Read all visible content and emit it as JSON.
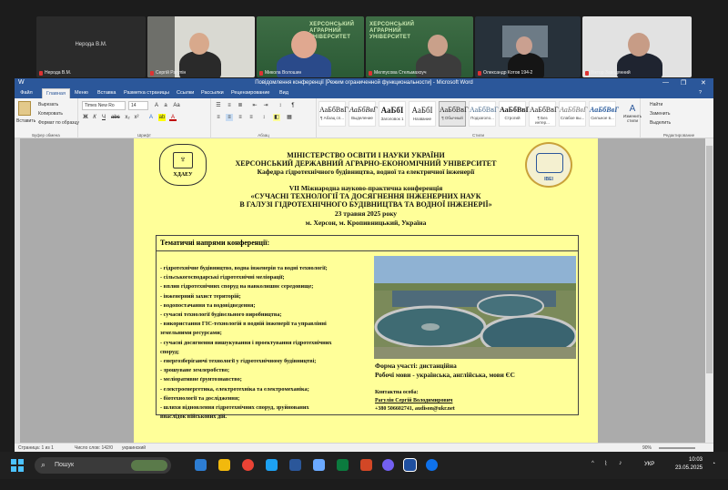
{
  "participants": [
    {
      "name": "Нерода В.М.",
      "caption": "Нерода В.М."
    },
    {
      "name": "Сергій Рагулін"
    },
    {
      "name": "Микола Волошин"
    },
    {
      "name": "Мелпусова Стельмахоуч"
    },
    {
      "name": "Олександр Котов 194-2"
    },
    {
      "name": "Віктор Заводянний"
    }
  ],
  "background_sign": "ХЕРСОНСЬКИЙ АГРАРНИЙ УНІВЕРСИТЕТ",
  "word": {
    "title": "Повідомлення конференції [Режим ограниченной функциональности] - Microsoft Word",
    "tabs": [
      "Файл",
      "Главная",
      "Меню",
      "Вставка",
      "Разметка страницы",
      "Ссылки",
      "Рассылки",
      "Рецензирование",
      "Вид"
    ],
    "ribbon": {
      "paste_label": "Вставить",
      "cut": "Вырезать",
      "copy": "Копировать",
      "format_painter": "Формат по образцу",
      "clipboard_group": "Буфер обмена",
      "font_name": "Times New Ro",
      "font_size": "14",
      "font_group": "Шрифт",
      "paragraph_group": "Абзац",
      "styles_group": "Стили",
      "styles": [
        {
          "sample": "АаБбВвГг,",
          "label": "¶ Абзац сп..."
        },
        {
          "sample": "АаБбВвГ",
          "label": "Выделение"
        },
        {
          "sample": "АаБбI",
          "label": "Заголовок 1"
        },
        {
          "sample": "АаБбI",
          "label": "Название"
        },
        {
          "sample": "АаБбВвГг",
          "label": "¶ Обычный"
        },
        {
          "sample": "АаБбВвГ",
          "label": "Подзаголо..."
        },
        {
          "sample": "АаБбВвГ",
          "label": "Строгий"
        },
        {
          "sample": "АаБбВвГ",
          "label": "¶ Без интер..."
        },
        {
          "sample": "АаБбВвГ",
          "label": "Слабое вы..."
        },
        {
          "sample": "АаБбВвГ",
          "label": "Сильное в..."
        }
      ],
      "change_styles": "Изменить стили",
      "find": "Найти",
      "replace": "Заменить",
      "select": "Выделить",
      "editing_group": "Редактирование"
    },
    "status": {
      "page": "Страница: 1 из 1",
      "words": "Число слов: 142/0",
      "language": "украинский",
      "zoom": "90%"
    }
  },
  "document": {
    "ministry": "МІНІСТЕРСТВО  ОСВІТИ  І НАУКИ УКРАЇНИ",
    "university": "ХЕРСОНСЬКИЙ ДЕРЖАВНИЙ АГРАРНО-ЕКОНОМІЧНИЙ  УНІВЕРСИТЕТ",
    "department": "Кафедра гідротехнічного будівництва, водної та електричної інженерії",
    "left_logo_text": "ХДАЕУ",
    "right_logo_text": "ІВЕІ",
    "conference_line": "VII Міжнародна науково-практична конференція",
    "conference_title_1": "«СУЧАСНІ  ТЕХНОЛОГІЇ  ТА ДОСЯГНЕННЯ  ІНЖЕНЕРНИХ  НАУК",
    "conference_title_2": "В ГАЛУЗІ ГІДРОТЕХНІЧНОГО  БУДІВНИЦТВА  ТА ВОДНОЇ ІНЖЕНЕРІЇ»",
    "date": "23 травня 2025 року",
    "place": "м. Херсон, м. Кропивницький, Україна",
    "topics_header": "Тематичні  напрями конференції:",
    "topics": [
      "- гідротехнічне будівництво, водна інженерія та водні технології;",
      "- сільськогосподарські гідротехнічні меліорації;",
      "- вплив гідротехнічних споруд на навколишнє середовище;",
      "- інженерний захист територій;",
      "- водопостачання та водовідведення;",
      "- сучасні технології будівельного виробництва;",
      "- використання ГІС-технологій в водній інженерії та управлінні",
      "   земельними ресурсами;",
      "- сучасні досягнення вишукування і проектування гідротехнічних",
      "   споруд;",
      "- енергозберігаючі технології у гідротехнічному будівництві;",
      "- зрошуване землеробство;",
      "- меліоративне ґрунтознавство;",
      "- електроенергетика, електротехніка та електромеханіка;",
      "- біотехнології та дослідження;",
      "-   шляхи   відновлення   гідротехнічних   споруд,   зруйнованих",
      "внаслідок військових дій."
    ],
    "participation_form": "Форма участі:  дистанційна",
    "languages": "Робочі мови - українська, англійська, мови ЄС",
    "contact_label": "Контактна особа:",
    "contact_name": "Рагулін Сергій Володимирович",
    "contact_phone": "+380 506602741, audison@ukr.net"
  },
  "taskbar": {
    "search_label": "Пошук",
    "lang": "УКР",
    "time": "10:03",
    "date": "23.05.2025"
  }
}
